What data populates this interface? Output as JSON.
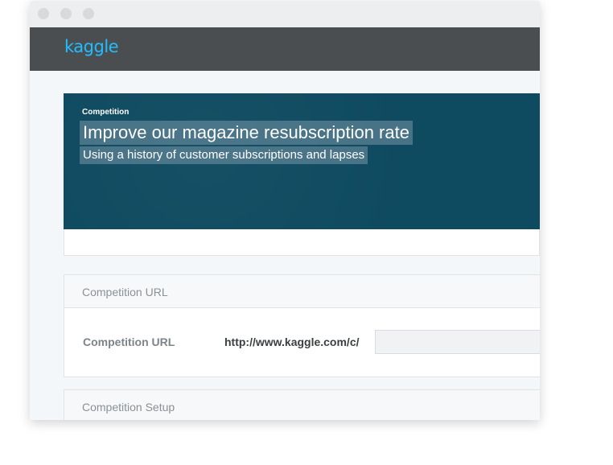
{
  "brand": {
    "logo_text": "kaggle",
    "logo_color": "#20beff"
  },
  "hero": {
    "label": "Competition",
    "title": "Improve our magazine resubscription rate",
    "subtitle": "Using a history of customer subscriptions and lapses",
    "background": "#0e4a60"
  },
  "url_section": {
    "header": "Competition URL",
    "field_label": "Competition URL",
    "prefix": "http://www.kaggle.com/c/",
    "input_value": ""
  },
  "setup_section": {
    "header": "Competition Setup"
  }
}
